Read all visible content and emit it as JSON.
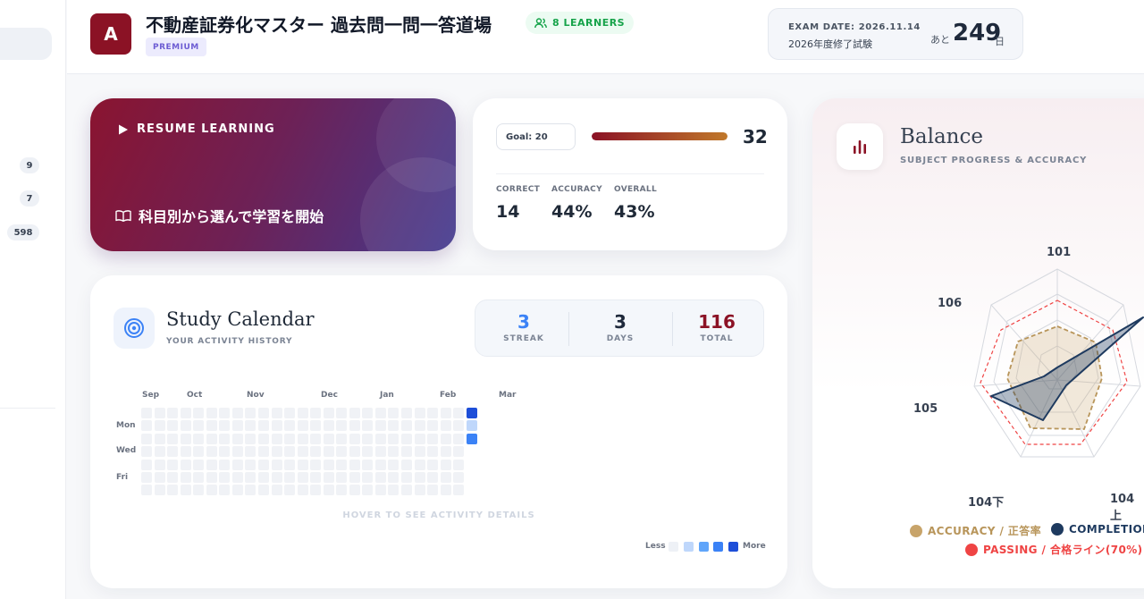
{
  "sidebar": {
    "badges": [
      "9",
      "7",
      "598"
    ]
  },
  "header": {
    "logo_letter": "A",
    "title": "不動産証券化マスター 過去問一問一答道場",
    "learners": "8 LEARNERS",
    "badge": "PREMIUM",
    "exam_date": "EXAM DATE: 2026.11.14",
    "exam_name": "2026年度修了試験",
    "countdown_prefix": "あと",
    "countdown_days": "249",
    "countdown_suffix": "日"
  },
  "resume": {
    "label": "RESUME LEARNING",
    "cta": "科目別から選んで学習を開始"
  },
  "goal": {
    "goal_label": "Goal: 20",
    "count": "32",
    "progress_fraction": 1.0,
    "stats": [
      {
        "label": "CORRECT",
        "value": "14",
        "color": "#16a34a"
      },
      {
        "label": "ACCURACY",
        "value": "44%",
        "color": "#8b1225"
      },
      {
        "label": "OVERALL",
        "value": "43%",
        "color": "#1e293b"
      }
    ]
  },
  "calendar": {
    "title": "Study Calendar",
    "subtitle": "YOUR ACTIVITY HISTORY",
    "stats": [
      {
        "value": "3",
        "label": "STREAK",
        "color": "#3b82f6"
      },
      {
        "value": "3",
        "label": "DAYS",
        "color": "#1e293b"
      },
      {
        "value": "116",
        "label": "TOTAL",
        "color": "#8b1225"
      }
    ],
    "months": [
      "Sep",
      "Oct",
      "Nov",
      "Dec",
      "Jan",
      "Feb",
      "Mar"
    ],
    "weekdays": [
      "Mon",
      "Wed",
      "Fri"
    ],
    "hover_hint": "HOVER TO SEE ACTIVITY DETAILS",
    "legend_less": "Less",
    "legend_more": "More",
    "legend_colors": [
      "#eef1f6",
      "#bfd7fb",
      "#60a5fa",
      "#3b82f6",
      "#1d4ed8"
    ],
    "active_days": [
      {
        "week": 25,
        "day": 0,
        "level": 4
      },
      {
        "week": 25,
        "day": 1,
        "level": 1
      },
      {
        "week": 25,
        "day": 2,
        "level": 3
      }
    ]
  },
  "balance": {
    "title": "Balance",
    "subtitle": "SUBJECT PROGRESS & ACCURACY",
    "axes": [
      "101",
      "106",
      "105",
      "104下",
      "104上"
    ],
    "legend": [
      {
        "label": "ACCURACY / 正答率",
        "color": "#c8a46a"
      },
      {
        "label": "COMPLETION",
        "color": "#1e3a5f"
      },
      {
        "label": "PASSING / 合格ライン(70%)",
        "color": "#ef4444"
      }
    ],
    "colors": {
      "accuracy": "#c8a46a",
      "completion": "#1e3a5f",
      "passing": "#ef4444"
    }
  }
}
